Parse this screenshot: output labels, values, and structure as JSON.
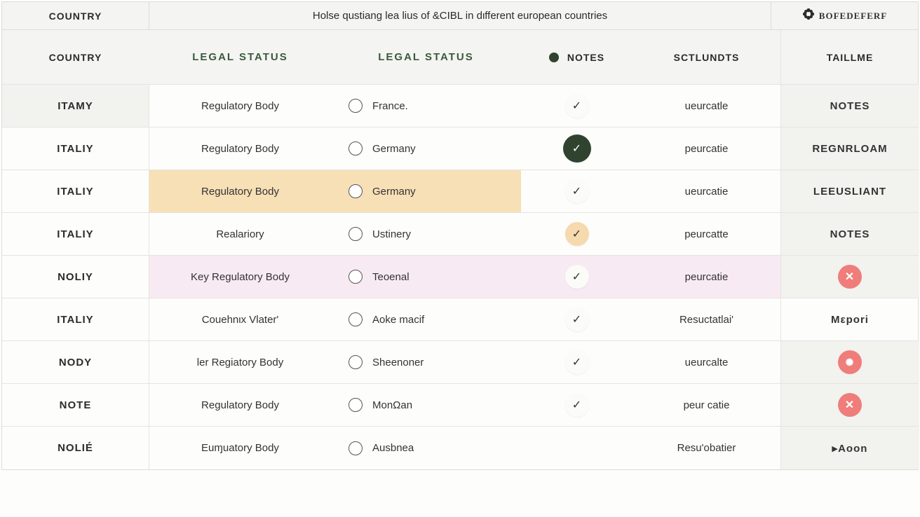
{
  "title_row": {
    "left": "COUNTRY",
    "mid": "Holse qustiang lea lius of &CIBL in dιfferent european countries",
    "brand": "BOFEDEFERF"
  },
  "headers": {
    "country": "COUNTRY",
    "legal1": "LEGAL STATUS",
    "legal2": "LEGAL STATUS",
    "notes": "NOTES",
    "sct": "SCTLUNDTS",
    "tail": "TAILLME"
  },
  "rows": [
    {
      "country": "ITAMY",
      "legal": "Regulatory Body",
      "legal2": "France.",
      "check": "plain",
      "sct": "ueurcatle",
      "tail": "NOTES",
      "variant": "shade-a tail-shade"
    },
    {
      "country": "ITALIY",
      "legal": "Regulatory Body",
      "legal2": "Germany",
      "check": "dark",
      "sct": "peurcatie",
      "tail": "REGNRLOAM",
      "variant": "tail-shade"
    },
    {
      "country": "ITALIY",
      "legal": "Regulatory Body",
      "legal2": "Germany",
      "check": "plain",
      "sct": "ueurcatie",
      "tail": "LEEUSLIANT",
      "variant": "peach tail-shade"
    },
    {
      "country": "ITALIY",
      "legal": "Realariory",
      "legal2": "Ustinery",
      "check": "peach",
      "sct": "peurcatte",
      "tail": "NOTES",
      "variant": "tail-shade"
    },
    {
      "country": "NOLIY",
      "legal": "Key Regulatory Body",
      "legal2": "Teoenal",
      "check": "plain",
      "sct": "peurcatie",
      "tail": "x",
      "variant": "pink tail-shade"
    },
    {
      "country": "ITALIY",
      "legal": "Couehnιx Vlater'",
      "legal2": "Aoke macif",
      "check": "plain",
      "sct": "Resuctatlai'",
      "tail": "Mεpori",
      "variant": ""
    },
    {
      "country": "NODY",
      "legal": "ler Regiatory Body",
      "legal2": "Sheenoner",
      "check": "plain",
      "sct": "ueurcalte",
      "tail": "gear",
      "variant": "tail-shade"
    },
    {
      "country": "NOTE",
      "legal": "Regulatory Body",
      "legal2": "MonΩan",
      "check": "plain",
      "sct": "peur catie",
      "tail": "x",
      "variant": "tail-shade"
    },
    {
      "country": "NOLIÉ",
      "legal": "Euɱuatory Body",
      "legal2": "Ausbnea",
      "check": "none",
      "sct": "Resu'obatier",
      "tail": "▸Aoon",
      "variant": "tail-shade last"
    }
  ]
}
